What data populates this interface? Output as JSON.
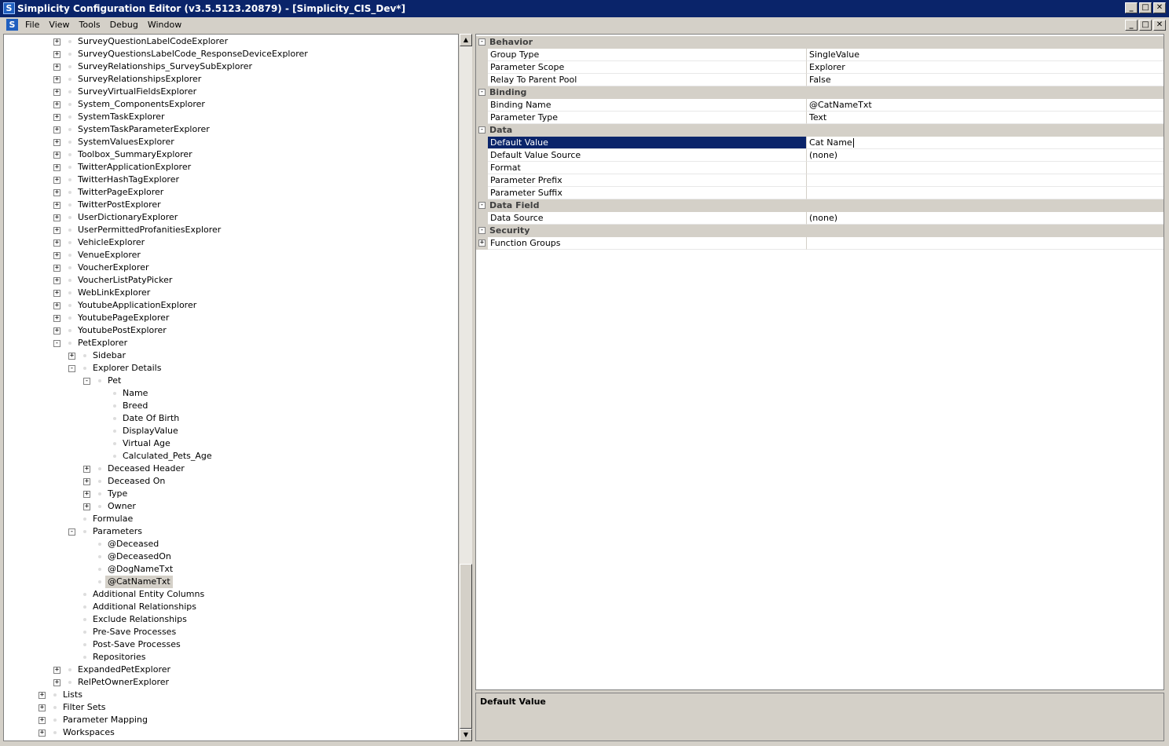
{
  "window": {
    "title": "Simplicity Configuration Editor (v3.5.5123.20879) - [Simplicity_CIS_Dev*]",
    "app_icon": "S",
    "minimize": "_",
    "maximize": "□",
    "close": "✕"
  },
  "menu": {
    "icon": "S",
    "items": [
      "File",
      "View",
      "Tools",
      "Debug",
      "Window"
    ]
  },
  "tree": {
    "rows": [
      {
        "label": "SurveyQuestionLabelCodeExplorer",
        "level": 3,
        "exp": "+"
      },
      {
        "label": "SurveyQuestionsLabelCode_ResponseDeviceExplorer",
        "level": 3,
        "exp": "+"
      },
      {
        "label": "SurveyRelationships_SurveySubExplorer",
        "level": 3,
        "exp": "+"
      },
      {
        "label": "SurveyRelationshipsExplorer",
        "level": 3,
        "exp": "+"
      },
      {
        "label": "SurveyVirtualFieldsExplorer",
        "level": 3,
        "exp": "+"
      },
      {
        "label": "System_ComponentsExplorer",
        "level": 3,
        "exp": "+"
      },
      {
        "label": "SystemTaskExplorer",
        "level": 3,
        "exp": "+"
      },
      {
        "label": "SystemTaskParameterExplorer",
        "level": 3,
        "exp": "+"
      },
      {
        "label": "SystemValuesExplorer",
        "level": 3,
        "exp": "+"
      },
      {
        "label": "Toolbox_SummaryExplorer",
        "level": 3,
        "exp": "+"
      },
      {
        "label": "TwitterApplicationExplorer",
        "level": 3,
        "exp": "+"
      },
      {
        "label": "TwitterHashTagExplorer",
        "level": 3,
        "exp": "+"
      },
      {
        "label": "TwitterPageExplorer",
        "level": 3,
        "exp": "+"
      },
      {
        "label": "TwitterPostExplorer",
        "level": 3,
        "exp": "+"
      },
      {
        "label": "UserDictionaryExplorer",
        "level": 3,
        "exp": "+"
      },
      {
        "label": "UserPermittedProfanitiesExplorer",
        "level": 3,
        "exp": "+"
      },
      {
        "label": "VehicleExplorer",
        "level": 3,
        "exp": "+"
      },
      {
        "label": "VenueExplorer",
        "level": 3,
        "exp": "+"
      },
      {
        "label": "VoucherExplorer",
        "level": 3,
        "exp": "+"
      },
      {
        "label": "VoucherListPatyPicker",
        "level": 3,
        "exp": "+"
      },
      {
        "label": "WebLinkExplorer",
        "level": 3,
        "exp": "+"
      },
      {
        "label": "YoutubeApplicationExplorer",
        "level": 3,
        "exp": "+"
      },
      {
        "label": "YoutubePageExplorer",
        "level": 3,
        "exp": "+"
      },
      {
        "label": "YoutubePostExplorer",
        "level": 3,
        "exp": "+"
      },
      {
        "label": "PetExplorer",
        "level": 3,
        "exp": "-"
      },
      {
        "label": "Sidebar",
        "level": 4,
        "exp": "+"
      },
      {
        "label": "Explorer Details",
        "level": 4,
        "exp": "-"
      },
      {
        "label": "Pet",
        "level": 5,
        "exp": "-"
      },
      {
        "label": "Name",
        "level": 6,
        "exp": ""
      },
      {
        "label": "Breed",
        "level": 6,
        "exp": ""
      },
      {
        "label": "Date Of Birth",
        "level": 6,
        "exp": ""
      },
      {
        "label": "DisplayValue",
        "level": 6,
        "exp": ""
      },
      {
        "label": "Virtual Age",
        "level": 6,
        "exp": ""
      },
      {
        "label": "Calculated_Pets_Age",
        "level": 6,
        "exp": ""
      },
      {
        "label": "Deceased Header",
        "level": 5,
        "exp": "+"
      },
      {
        "label": "Deceased On",
        "level": 5,
        "exp": "+"
      },
      {
        "label": "Type",
        "level": 5,
        "exp": "+"
      },
      {
        "label": "Owner",
        "level": 5,
        "exp": "+"
      },
      {
        "label": "Formulae",
        "level": 4,
        "exp": ""
      },
      {
        "label": "Parameters",
        "level": 4,
        "exp": "-"
      },
      {
        "label": "@Deceased",
        "level": 5,
        "exp": ""
      },
      {
        "label": "@DeceasedOn",
        "level": 5,
        "exp": ""
      },
      {
        "label": "@DogNameTxt",
        "level": 5,
        "exp": ""
      },
      {
        "label": "@CatNameTxt",
        "level": 5,
        "exp": "",
        "selected": true
      },
      {
        "label": "Additional Entity Columns",
        "level": 4,
        "exp": ""
      },
      {
        "label": "Additional Relationships",
        "level": 4,
        "exp": ""
      },
      {
        "label": "Exclude Relationships",
        "level": 4,
        "exp": ""
      },
      {
        "label": "Pre-Save Processes",
        "level": 4,
        "exp": ""
      },
      {
        "label": "Post-Save Processes",
        "level": 4,
        "exp": ""
      },
      {
        "label": "Repositories",
        "level": 4,
        "exp": ""
      },
      {
        "label": "ExpandedPetExplorer",
        "level": 3,
        "exp": "+"
      },
      {
        "label": "RelPetOwnerExplorer",
        "level": 3,
        "exp": "+"
      },
      {
        "label": "Lists",
        "level": 2,
        "exp": "+"
      },
      {
        "label": "Filter Sets",
        "level": 2,
        "exp": "+"
      },
      {
        "label": "Parameter Mapping",
        "level": 2,
        "exp": "+"
      },
      {
        "label": "Workspaces",
        "level": 2,
        "exp": "+"
      }
    ]
  },
  "scrollbar": {
    "up": "▲",
    "down": "▼"
  },
  "propgrid": {
    "rows": [
      {
        "type": "cat",
        "label": "Behavior"
      },
      {
        "type": "prop",
        "name": "Group Type",
        "value": "SingleValue"
      },
      {
        "type": "prop",
        "name": "Parameter Scope",
        "value": "Explorer"
      },
      {
        "type": "prop",
        "name": "Relay To Parent Pool",
        "value": "False"
      },
      {
        "type": "cat",
        "label": "Binding"
      },
      {
        "type": "prop",
        "name": "Binding Name",
        "value": "@CatNameTxt"
      },
      {
        "type": "prop",
        "name": "Parameter Type",
        "value": "Text"
      },
      {
        "type": "cat",
        "label": "Data"
      },
      {
        "type": "prop",
        "name": "Default Value",
        "value": "Cat Name",
        "selected": true
      },
      {
        "type": "prop",
        "name": "Default Value Source",
        "value": "(none)"
      },
      {
        "type": "prop",
        "name": "Format",
        "value": ""
      },
      {
        "type": "prop",
        "name": "Parameter Prefix",
        "value": ""
      },
      {
        "type": "prop",
        "name": "Parameter Suffix",
        "value": ""
      },
      {
        "type": "cat",
        "label": "Data Field"
      },
      {
        "type": "prop",
        "name": "Data Source",
        "value": "(none)"
      },
      {
        "type": "cat",
        "label": "Security"
      },
      {
        "type": "prop",
        "name": "Function Groups",
        "value": "",
        "expander": "+"
      }
    ]
  },
  "description": {
    "title": "Default Value"
  }
}
